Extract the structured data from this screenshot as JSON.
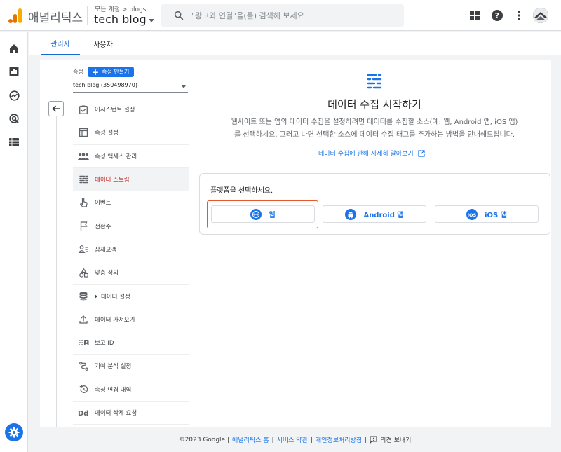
{
  "header": {
    "app_name": "애널리틱스",
    "breadcrumb": "모든 계정 > blogs",
    "property_name": "tech blog",
    "search_placeholder": "\"광고와 연결\"을(를) 검색해 보세요",
    "icons": [
      "apps-grid-icon",
      "help-icon",
      "more-vert-icon",
      "account-avatar"
    ]
  },
  "tabs": [
    {
      "label": "관리자",
      "active": true
    },
    {
      "label": "사용자",
      "active": false
    }
  ],
  "property": {
    "label": "속성",
    "create_label": "속성 만들기",
    "selected": "tech blog (350498970)"
  },
  "menu": [
    {
      "label": "어시스턴트 설정",
      "icon": "checklist-icon"
    },
    {
      "label": "속성 설정",
      "icon": "web-layout-icon"
    },
    {
      "label": "속성 액세스 관리",
      "icon": "people-icon"
    },
    {
      "label": "데이터 스트림",
      "icon": "data-stream-icon",
      "active": true
    },
    {
      "label": "이벤트",
      "icon": "touch-icon"
    },
    {
      "label": "전환수",
      "icon": "flag-icon"
    },
    {
      "label": "잠재고객",
      "icon": "audience-icon"
    },
    {
      "label": "맞춤 정의",
      "icon": "shapes-icon"
    },
    {
      "label": "데이터 설정",
      "icon": "database-icon",
      "expandable": true
    },
    {
      "label": "데이터 가져오기",
      "icon": "upload-icon"
    },
    {
      "label": "보고 ID",
      "icon": "reporting-id-icon"
    },
    {
      "label": "기여 분석 설정",
      "icon": "attribution-icon"
    },
    {
      "label": "속성 변경 내역",
      "icon": "history-icon"
    },
    {
      "label": "데이터 삭제 요청",
      "icon": "delete-request-icon"
    }
  ],
  "content": {
    "title": "데이터 수집 시작하기",
    "description_line1": "웹사이트 또는 앱의 데이터 수집을 설정하려면 데이터를 수집할 소스(예: 웹, Android 앱, iOS 앱)",
    "description_line2": "를 선택하세요. 그러고 나면 선택한 소스에 데이터 수집 태그를 추가하는 방법을 안내해드립니다.",
    "learn_more": "데이터 수집에 관해 자세히 알아보기",
    "platform_prompt": "플랫폼을 선택하세요.",
    "platforms": [
      {
        "label": "웹",
        "icon": "globe-icon"
      },
      {
        "label": "Android 앱",
        "icon": "android-icon"
      },
      {
        "label": "iOS 앱",
        "icon": "ios-icon"
      }
    ]
  },
  "footer": {
    "copyright": "©2023 Google |",
    "home_link": "애널리틱스 홈",
    "sep1": "|",
    "terms_link": "서비스 약관",
    "sep2": "|",
    "privacy_link": "개인정보처리방침",
    "sep3": "|",
    "feedback": "의견 보내기"
  },
  "colors": {
    "accent": "#1a73e8",
    "active_menu_text": "#c5221f",
    "highlight_border": "#e8572a"
  }
}
